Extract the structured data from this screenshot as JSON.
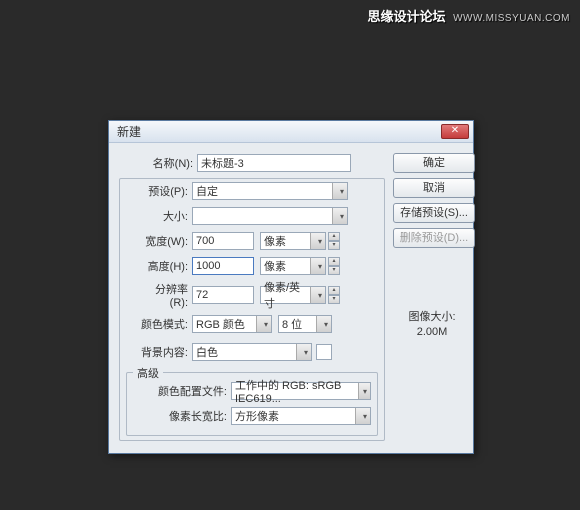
{
  "watermark": {
    "text": "思缘设计论坛",
    "url": "WWW.MISSYUAN.COM"
  },
  "dialog": {
    "title": "新建",
    "labels": {
      "name": "名称(N):",
      "preset": "预设(P):",
      "size": "大小:",
      "width": "宽度(W):",
      "height": "高度(H):",
      "resolution": "分辨率(R):",
      "colormode": "颜色模式:",
      "bgcontent": "背景内容:",
      "advanced": "高级",
      "profile": "颜色配置文件:",
      "aspect": "像素长宽比:"
    },
    "values": {
      "name": "未标题-3",
      "preset": "自定",
      "size": "",
      "width": "700",
      "height": "1000",
      "resolution": "72",
      "unit_px": "像素",
      "unit_ppi": "像素/英寸",
      "colormode": "RGB 颜色",
      "depth": "8 位",
      "bgcontent": "白色",
      "profile": "工作中的 RGB: sRGB IEC619...",
      "aspect": "方形像素"
    },
    "buttons": {
      "ok": "确定",
      "cancel": "取消",
      "savepreset": "存储预设(S)...",
      "deletepreset": "删除预设(D)..."
    },
    "imagesize": {
      "label": "图像大小:",
      "value": "2.00M"
    }
  }
}
